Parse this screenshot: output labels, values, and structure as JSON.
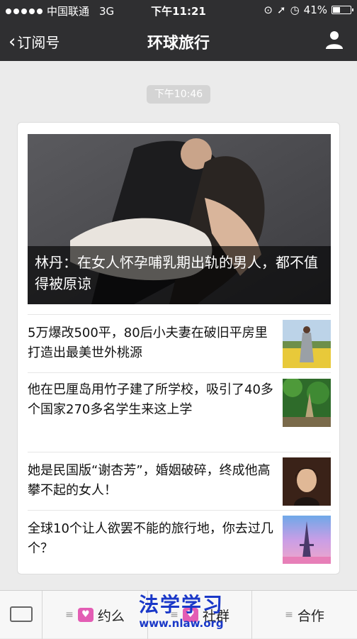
{
  "status_bar": {
    "carrier": "中国联通",
    "network": "3G",
    "time": "下午11:21",
    "battery": "41%",
    "battery_level": 0.41
  },
  "nav": {
    "back_label": "订阅号",
    "title": "环球旅行"
  },
  "chat": {
    "timestamp": "下午10:46"
  },
  "article_card": {
    "cover_title": "林丹：在女人怀孕哺乳期出轨的男人，都不值得被原谅",
    "items": [
      {
        "title": "5万爆改500平，80后小夫妻在破旧平房里打造出最美世外桃源",
        "thumb": "woman-in-flower-field-image"
      },
      {
        "title": "他在巴厘岛用竹子建了所学校，吸引了40多个国家270多名学生来这上学",
        "thumb": "bamboo-jungle-image"
      },
      {
        "title": "她是民国版“谢杏芳”，婚姻破碎，终成他高攀不起的女人！",
        "thumb": "portrait-woman-image"
      },
      {
        "title": "全球10个让人欲罢不能的旅行地，你去过几个？",
        "thumb": "eiffel-tower-image"
      }
    ]
  },
  "toolbar": {
    "menu1": "约么",
    "menu2": "社群",
    "menu3": "合作"
  },
  "watermark": {
    "title": "法学学习",
    "url": "www.nlaw.org"
  },
  "colors": {
    "nav_bg": "#2f2f31",
    "page_bg": "#ebebeb",
    "watermark": "#1a38c8",
    "menu_icon": "#e35db4"
  }
}
